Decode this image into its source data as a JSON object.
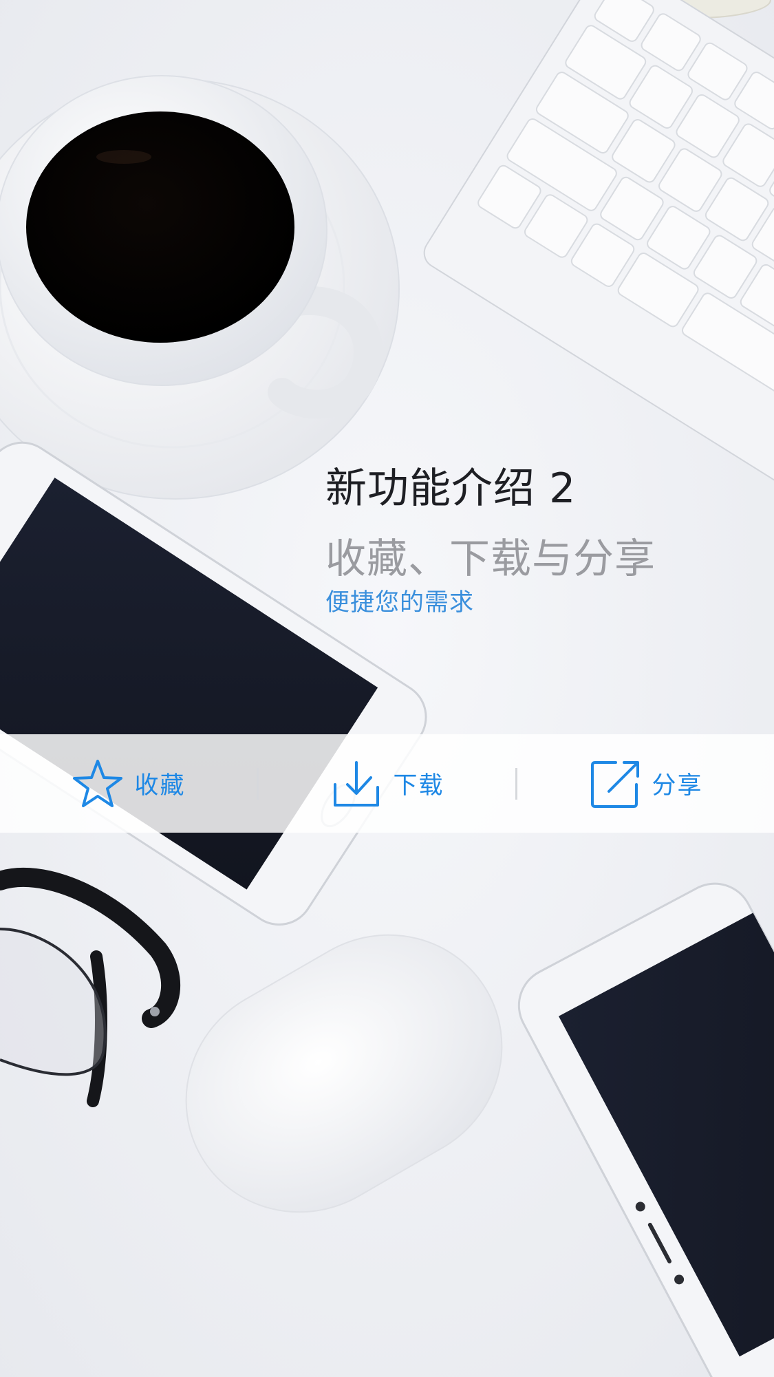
{
  "intro": {
    "title": "新功能介绍 2",
    "subtitle": "收藏、下载与分享",
    "tagline": "便捷您的需求"
  },
  "actions": [
    {
      "label": "收藏",
      "icon": "star-icon"
    },
    {
      "label": "下载",
      "icon": "download-icon"
    },
    {
      "label": "分享",
      "icon": "share-icon"
    }
  ],
  "colors": {
    "accent": "#1e88e5",
    "title": "#1e1f24",
    "subtitle": "#9a9ba0",
    "tagline": "#3a8fdc"
  }
}
